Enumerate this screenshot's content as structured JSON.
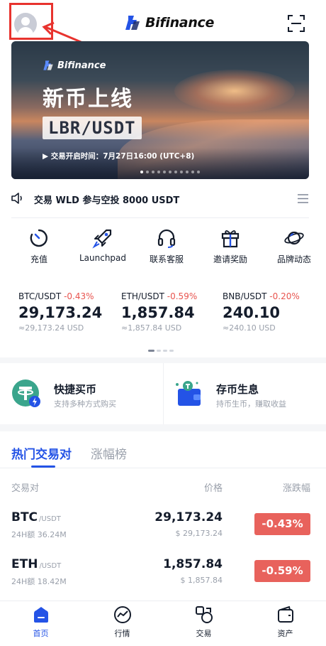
{
  "header": {
    "brand_name": "Bifinance",
    "avatar_icon": "user-avatar-icon",
    "scan_icon": "scan-icon",
    "brand_color": "#2453e6",
    "highlight_color": "#e8332e"
  },
  "banner": {
    "logo_text": "Bifinance",
    "title": "新币上线",
    "pair": "LBR/USDT",
    "time_text": "▶ 交易开启时间：7月27日16:00 (UTC+8)"
  },
  "notice": {
    "icon": "speaker-icon",
    "text": "交易 WLD 参与空投 8000 USDT",
    "menu_icon": "list-icon"
  },
  "quick_actions": [
    {
      "label": "充值",
      "icon": "deposit-icon"
    },
    {
      "label": "Launchpad",
      "icon": "rocket-icon"
    },
    {
      "label": "联系客服",
      "icon": "headset-icon"
    },
    {
      "label": "邀请奖励",
      "icon": "gift-icon"
    },
    {
      "label": "品牌动态",
      "icon": "planet-icon"
    }
  ],
  "tickers": [
    {
      "pair": "BTC/USDT",
      "change": "-0.43%",
      "price": "29,173.24",
      "usd": "≈29,173.24 USD"
    },
    {
      "pair": "ETH/USDT",
      "change": "-0.59%",
      "price": "1,857.84",
      "usd": "≈1,857.84 USD"
    },
    {
      "pair": "BNB/USDT",
      "change": "-0.20%",
      "price": "240.10",
      "usd": "≈240.10 USD"
    }
  ],
  "cards": [
    {
      "title": "快捷买币",
      "subtitle": "支持多种方式购买",
      "icon": "tether-icon"
    },
    {
      "title": "存币生息",
      "subtitle": "持币生币，赚取收益",
      "icon": "wallet-icon"
    }
  ],
  "market": {
    "tabs": [
      "热门交易对",
      "涨幅榜"
    ],
    "columns": {
      "pair": "交易对",
      "price": "价格",
      "change": "涨跌幅"
    },
    "rows": [
      {
        "base": "BTC",
        "quote": "/USDT",
        "volume": "24H额 36.24M",
        "price": "29,173.24",
        "usd": "$ 29,173.24",
        "change": "-0.43%"
      },
      {
        "base": "ETH",
        "quote": "/USDT",
        "volume": "24H额 18.42M",
        "price": "1,857.84",
        "usd": "$ 1,857.84",
        "change": "-0.59%"
      }
    ],
    "negative_color": "#e8625c"
  },
  "tabbar": [
    {
      "label": "首页",
      "icon": "home-icon",
      "active": true
    },
    {
      "label": "行情",
      "icon": "chart-icon",
      "active": false
    },
    {
      "label": "交易",
      "icon": "trade-icon",
      "active": false
    },
    {
      "label": "资产",
      "icon": "assets-icon",
      "active": false
    }
  ]
}
